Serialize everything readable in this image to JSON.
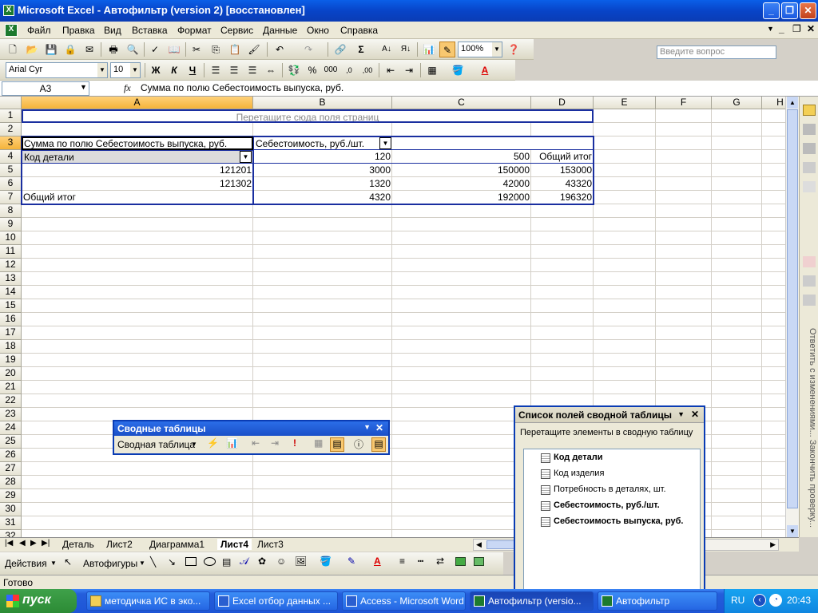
{
  "window": {
    "title": "Microsoft Excel - Автофильтр (version 2)  [восстановлен]",
    "app_icon": "excel-icon"
  },
  "menu": {
    "items": [
      "Файл",
      "Правка",
      "Вид",
      "Вставка",
      "Формат",
      "Сервис",
      "Данные",
      "Окно",
      "Справка"
    ],
    "ask_placeholder": "Введите вопрос"
  },
  "standard_toolbar": {
    "zoom": "100%"
  },
  "format_toolbar": {
    "font": "Arial Cyr",
    "size": "10",
    "bold": "Ж",
    "italic": "К",
    "underline": "Ч",
    "percent": "%",
    "thousands": "000"
  },
  "formula_bar": {
    "name_box": "A3",
    "fx": "fx",
    "formula": "Сумма по полю Себестоимость выпуска, руб."
  },
  "grid": {
    "columns": [
      "A",
      "B",
      "C",
      "D",
      "E",
      "F",
      "G",
      "H"
    ],
    "rows": [
      "1",
      "2",
      "3",
      "4",
      "5",
      "6",
      "7",
      "8",
      "9",
      "10",
      "11",
      "12",
      "13",
      "14",
      "15",
      "16",
      "17",
      "18",
      "19",
      "20",
      "21",
      "22",
      "23",
      "24",
      "25",
      "26",
      "27",
      "28",
      "29",
      "30",
      "31",
      "32"
    ],
    "page_drop_zone": "Перетащите сюда поля страниц",
    "data_field": "Сумма по полю Себестоимость выпуска, руб.",
    "column_field": "Себестоимость, руб./шт.",
    "row_field": "Код  детали",
    "col_items": [
      "120",
      "500",
      "Общий итог"
    ],
    "body": [
      {
        "label": "121201",
        "values": [
          "3000",
          "150000",
          "153000"
        ]
      },
      {
        "label": "121302",
        "values": [
          "1320",
          "42000",
          "43320"
        ]
      }
    ],
    "total": {
      "label": "Общий итог",
      "values": [
        "4320",
        "192000",
        "196320"
      ]
    }
  },
  "sheet_tabs": {
    "items": [
      "Деталь",
      "Лист2",
      "Диаграмма1",
      "Лист4",
      "Лист3"
    ],
    "active": "Лист4"
  },
  "draw_toolbar": {
    "actions": "Действия",
    "autoshapes": "Автофигуры"
  },
  "status": {
    "text": "Готово"
  },
  "pivot_toolbar": {
    "title": "Сводные таблицы",
    "menu": "Сводная таблица"
  },
  "field_list": {
    "title": "Список полей сводной таблицы",
    "instruction": "Перетащите элементы в сводную таблицу",
    "fields": [
      {
        "label": "Код  детали",
        "bold": true
      },
      {
        "label": "Код изделия",
        "bold": false
      },
      {
        "label": "Потребность в деталях, шт.",
        "bold": false
      },
      {
        "label": "Себестоимость, руб./шт.",
        "bold": true
      },
      {
        "label": "Себестоимость выпуска, руб.",
        "bold": true
      }
    ]
  },
  "task_pane": {
    "text": "Ответить с изменениями...  Закончить проверку..."
  },
  "taskbar": {
    "start": "пуск",
    "items": [
      {
        "label": "методичка ИС в эко...",
        "icon": "folder-icon"
      },
      {
        "label": "Excel отбор данных ...",
        "icon": "word-icon"
      },
      {
        "label": "Access - Microsoft Word",
        "icon": "word-icon"
      },
      {
        "label": "Автофильтр (versio...",
        "icon": "excel-icon"
      },
      {
        "label": "Автофильтр",
        "icon": "excel-icon"
      }
    ],
    "lang": "RU",
    "clock": "20:43"
  }
}
